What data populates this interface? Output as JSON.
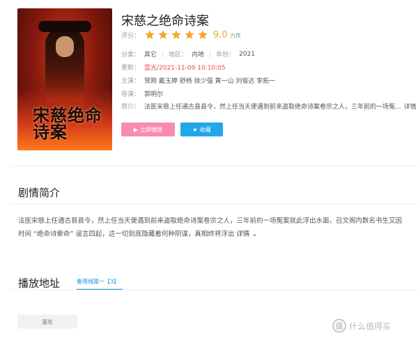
{
  "movie": {
    "title": "宋慈之绝命诗案",
    "poster_text": "宋慈绝命诗案",
    "rating": {
      "label": "评分：",
      "stars": 5,
      "score": "9.0",
      "suffix": "力荐",
      "star_color": "#f6a623"
    },
    "category": {
      "label": "分类：",
      "value": "其它"
    },
    "region": {
      "label": "地区：",
      "value": "内地"
    },
    "year": {
      "label": "年份：",
      "value": "2021"
    },
    "update": {
      "label": "更新：",
      "value": "蓝光/2021-11-09 10:10:05"
    },
    "cast": {
      "label": "主演：",
      "value": "贺刚  戴玉婷  舒杨  徐少强  黄一山  刘俊达  李拓一"
    },
    "director": {
      "label": "导演：",
      "value": "郭明尔"
    },
    "intro": {
      "label": "简介：",
      "value": "法医宋慈上任通古县县令，然上任当天便遇到前来盗取绝命诗案卷宗之人，三年前的一场冤...",
      "more": "详情 ›"
    },
    "buttons": {
      "play": "立即播放",
      "favorite": "收藏"
    }
  },
  "plot": {
    "heading": "剧情简介",
    "line1": "法医宋慈上任通古县县令，然上任当天便遇到前来盗取绝命诗案卷宗之人，三年前的一场冤案就此浮出水面，召文阁内数名书生又因",
    "line2": "时间 “绝命诗索命” 谣言四起，这一切到底隐藏着何种阴谋，真相终将浮出",
    "more": "详情 ⌄"
  },
  "playback": {
    "heading": "播放地址",
    "tab": "备用线路一【3】",
    "episodes": [
      "蓝光"
    ]
  },
  "watermark": {
    "icon": "值",
    "text": "什么值得买"
  },
  "colors": {
    "accent_red": "#e94b3c",
    "play_button": "#f98bb0",
    "fav_button": "#22a7e8",
    "tab_blue": "#1a90d8"
  }
}
